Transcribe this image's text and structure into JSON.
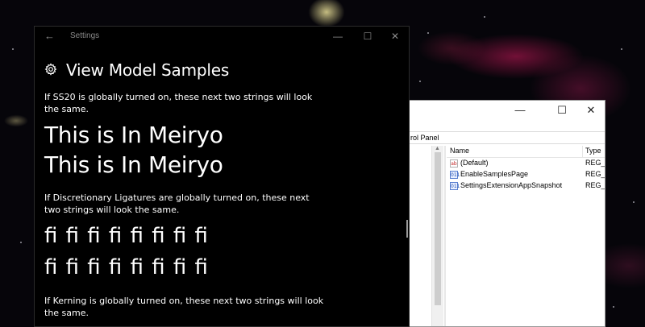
{
  "regedit": {
    "address": "rol Panel",
    "columns": {
      "name": "Name",
      "type": "Type"
    },
    "rows": [
      {
        "icon": "string-value-icon",
        "glyph": "ab",
        "name": "(Default)",
        "type": "REG_S"
      },
      {
        "icon": "dword-value-icon",
        "glyph": "011",
        "name": "EnableSamplesPage",
        "type": "REG_D"
      },
      {
        "icon": "dword-value-icon",
        "glyph": "011",
        "name": "SettingsExtensionAppSnapshot",
        "type": "REG_B"
      }
    ],
    "controls": {
      "minimize": "—",
      "maximize": "☐",
      "close": "✕"
    }
  },
  "settings": {
    "window_title": "Settings",
    "back_glyph": "←",
    "controls": {
      "minimize": "—",
      "maximize": "☐",
      "close": "✕"
    },
    "page_title": "View Model Samples",
    "para_ss20": "If SS20 is globally turned on, these next two strings will look the same.",
    "meiryo_line_1": "This is In Meiryo",
    "meiryo_line_2": "This is In Meiryo",
    "para_ligatures": "If Discretionary Ligatures are globally turned on, these next two strings will look the same.",
    "ligature_line_1": "ﬁ ﬁ ﬁ ﬁ ﬁ ﬁ ﬁ ﬁ",
    "ligature_line_2": "ﬁ ﬁ ﬁ ﬁ ﬁ ﬁ ﬁ ﬁ",
    "para_kerning": "If Kerning is globally turned on, these next two strings will look the same."
  }
}
